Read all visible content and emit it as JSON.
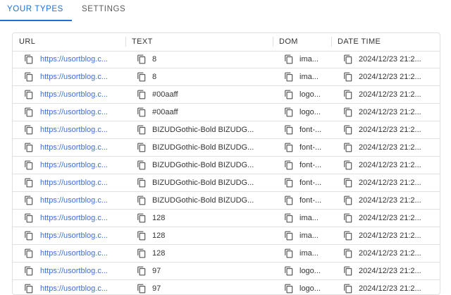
{
  "tabs": [
    {
      "label": "YOUR TYPES",
      "active": true
    },
    {
      "label": "SETTINGS",
      "active": false
    }
  ],
  "table": {
    "headers": [
      "URL",
      "TEXT",
      "DOM",
      "DATE TIME"
    ],
    "rows": [
      {
        "url": "https://usortblog.c...",
        "text": "8",
        "dom": "ima...",
        "datetime": "2024/12/23 21:2..."
      },
      {
        "url": "https://usortblog.c...",
        "text": "8",
        "dom": "ima...",
        "datetime": "2024/12/23 21:2..."
      },
      {
        "url": "https://usortblog.c...",
        "text": "#00aaff",
        "dom": "logo...",
        "datetime": "2024/12/23 21:2..."
      },
      {
        "url": "https://usortblog.c...",
        "text": "#00aaff",
        "dom": "logo...",
        "datetime": "2024/12/23 21:2..."
      },
      {
        "url": "https://usortblog.c...",
        "text": "BIZUDGothic-Bold BIZUDG...",
        "dom": "font-...",
        "datetime": "2024/12/23 21:2..."
      },
      {
        "url": "https://usortblog.c...",
        "text": "BIZUDGothic-Bold BIZUDG...",
        "dom": "font-...",
        "datetime": "2024/12/23 21:2..."
      },
      {
        "url": "https://usortblog.c...",
        "text": "BIZUDGothic-Bold BIZUDG...",
        "dom": "font-...",
        "datetime": "2024/12/23 21:2..."
      },
      {
        "url": "https://usortblog.c...",
        "text": "BIZUDGothic-Bold BIZUDG...",
        "dom": "font-...",
        "datetime": "2024/12/23 21:2..."
      },
      {
        "url": "https://usortblog.c...",
        "text": "BIZUDGothic-Bold BIZUDG...",
        "dom": "font-...",
        "datetime": "2024/12/23 21:2..."
      },
      {
        "url": "https://usortblog.c...",
        "text": "128",
        "dom": "ima...",
        "datetime": "2024/12/23 21:2..."
      },
      {
        "url": "https://usortblog.c...",
        "text": "128",
        "dom": "ima...",
        "datetime": "2024/12/23 21:2..."
      },
      {
        "url": "https://usortblog.c...",
        "text": "128",
        "dom": "ima...",
        "datetime": "2024/12/23 21:2..."
      },
      {
        "url": "https://usortblog.c...",
        "text": "97",
        "dom": "logo...",
        "datetime": "2024/12/23 21:2..."
      },
      {
        "url": "https://usortblog.c...",
        "text": "97",
        "dom": "logo...",
        "datetime": "2024/12/23 21:2..."
      }
    ]
  },
  "icons": {
    "copy": "copy-icon"
  },
  "colors": {
    "accent": "#1f6fd8",
    "link": "#3f6fd6",
    "border": "#e0e0e0"
  }
}
